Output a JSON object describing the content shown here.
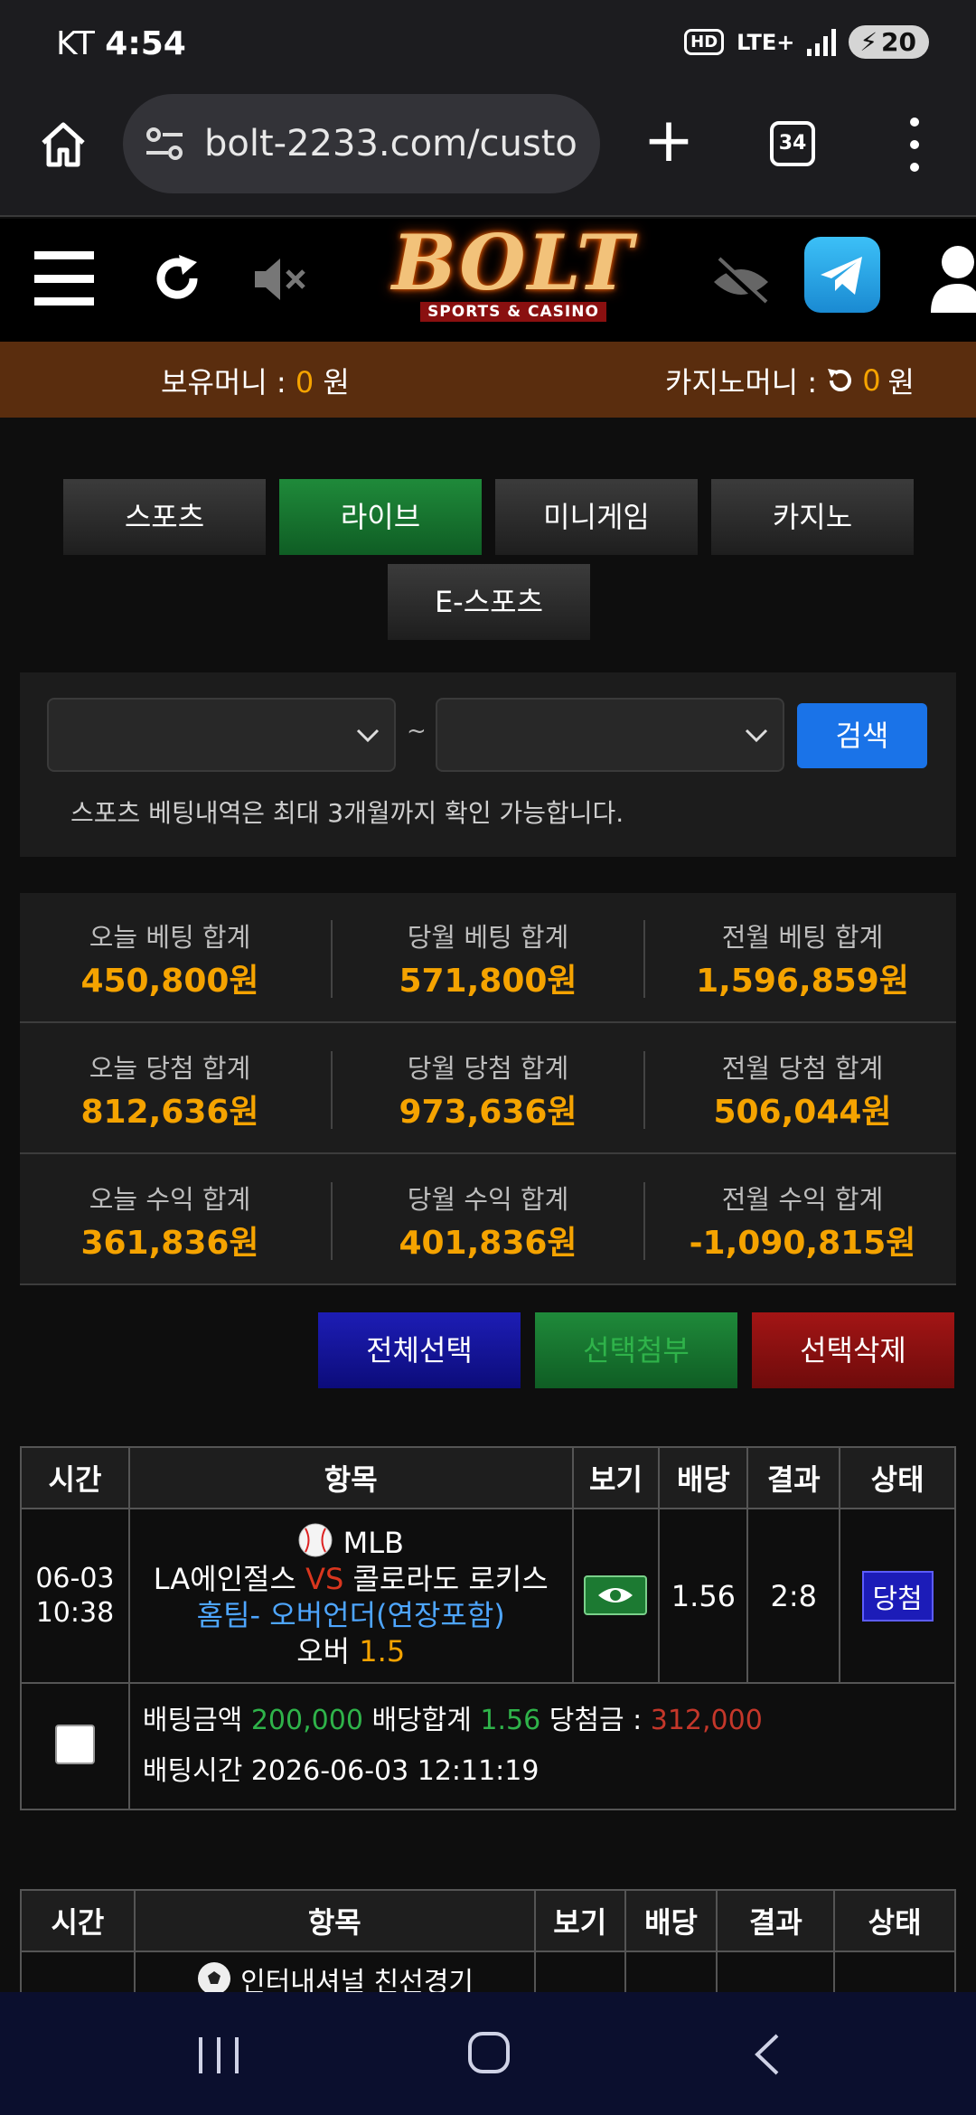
{
  "status": {
    "carrier": "KT",
    "time": "4:54",
    "network": "LTE+",
    "hd": "HD",
    "battery": "20"
  },
  "browser": {
    "url": "bolt-2233.com/custo",
    "tab_count": "34"
  },
  "header": {
    "logo_text": "BOLT",
    "logo_sub": "SPORTS & CASINO"
  },
  "money": {
    "hold_label": "보유머니 :",
    "hold_value": "0",
    "casino_label": "카지노머니 :",
    "casino_value": "0",
    "unit": "원"
  },
  "tabs": [
    {
      "label": "스포츠",
      "active": false
    },
    {
      "label": "라이브",
      "active": true
    },
    {
      "label": "미니게임",
      "active": false
    },
    {
      "label": "카지노",
      "active": false
    },
    {
      "label": "E-스포츠",
      "active": false
    }
  ],
  "search": {
    "tilde": "~",
    "button": "검색",
    "note": "스포츠 베팅내역은 최대 3개월까지 확인 가능합니다."
  },
  "stats": [
    [
      {
        "label": "오늘 베팅 합계",
        "value": "450,800원"
      },
      {
        "label": "당월 베팅 합계",
        "value": "571,800원"
      },
      {
        "label": "전월 베팅 합계",
        "value": "1,596,859원"
      }
    ],
    [
      {
        "label": "오늘 당첨 합계",
        "value": "812,636원"
      },
      {
        "label": "당월 당첨 합계",
        "value": "973,636원"
      },
      {
        "label": "전월 당첨 합계",
        "value": "506,044원"
      }
    ],
    [
      {
        "label": "오늘 수익 합계",
        "value": "361,836원"
      },
      {
        "label": "당월 수익 합계",
        "value": "401,836원"
      },
      {
        "label": "전월 수익 합계",
        "value": "-1,090,815원"
      }
    ]
  ],
  "actions": {
    "select_all": "전체선택",
    "attach": "선택첨부",
    "delete": "선택삭제"
  },
  "table_headers": [
    "시간",
    "항목",
    "보기",
    "배당",
    "결과",
    "상태"
  ],
  "bet1": {
    "date": "06-03",
    "time": "10:38",
    "league": "MLB",
    "home": "LA에인절스",
    "vs": "VS",
    "away": "콜로라도 로키스",
    "market": "홈팀- 오버언더(연장포함)",
    "pick": "오버",
    "line": "1.5",
    "odds": "1.56",
    "result": "2:8",
    "status": "당첨",
    "amount_label": "배팅금액",
    "amount": "200,000",
    "total_odds_label": "배당합계",
    "total_odds": "1.56",
    "payout_label": "당첨금 :",
    "payout": "312,000",
    "bet_time_label": "배팅시간",
    "bet_time": "2026-06-03 12:11:19"
  },
  "bet2": {
    "league_partial": "인터내셔널 친선경기"
  }
}
